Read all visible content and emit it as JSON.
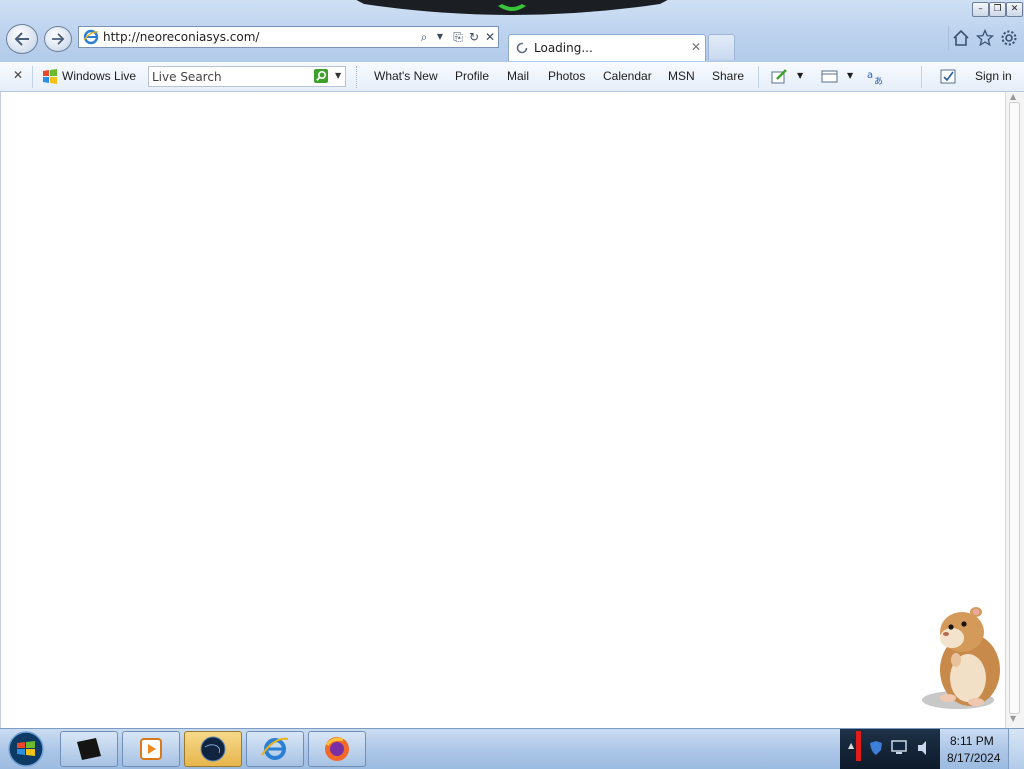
{
  "browser": {
    "address": {
      "url": "http://neoreconiasys.com/"
    },
    "tab": {
      "title": "Loading..."
    },
    "window_buttons": {
      "minimize": "–",
      "restore": "❐",
      "close": "✕"
    }
  },
  "toolbar": {
    "close_glyph": "✕",
    "windows_live": "Windows Live",
    "search_placeholder": "Live Search",
    "links": [
      "What's New",
      "Profile",
      "Mail",
      "Photos",
      "Calendar",
      "MSN",
      "Share"
    ],
    "sign_in": "Sign in"
  },
  "taskbar": {
    "clock_time": "8:11 PM",
    "clock_date": "8/17/2024"
  },
  "icons": {
    "back": "back-arrow-icon",
    "forward": "forward-arrow-icon",
    "ie": "internet-explorer-icon",
    "search": "search-icon",
    "compat": "compatibility-view-icon",
    "refresh": "refresh-icon",
    "stop": "stop-icon",
    "home": "home-icon",
    "favorites": "star-icon",
    "tools": "gear-icon",
    "mascot": "hamster-mascot"
  },
  "colors": {
    "chrome": "#bcd2ee",
    "accent": "#1e5fb4",
    "search_go": "#3da02a"
  }
}
